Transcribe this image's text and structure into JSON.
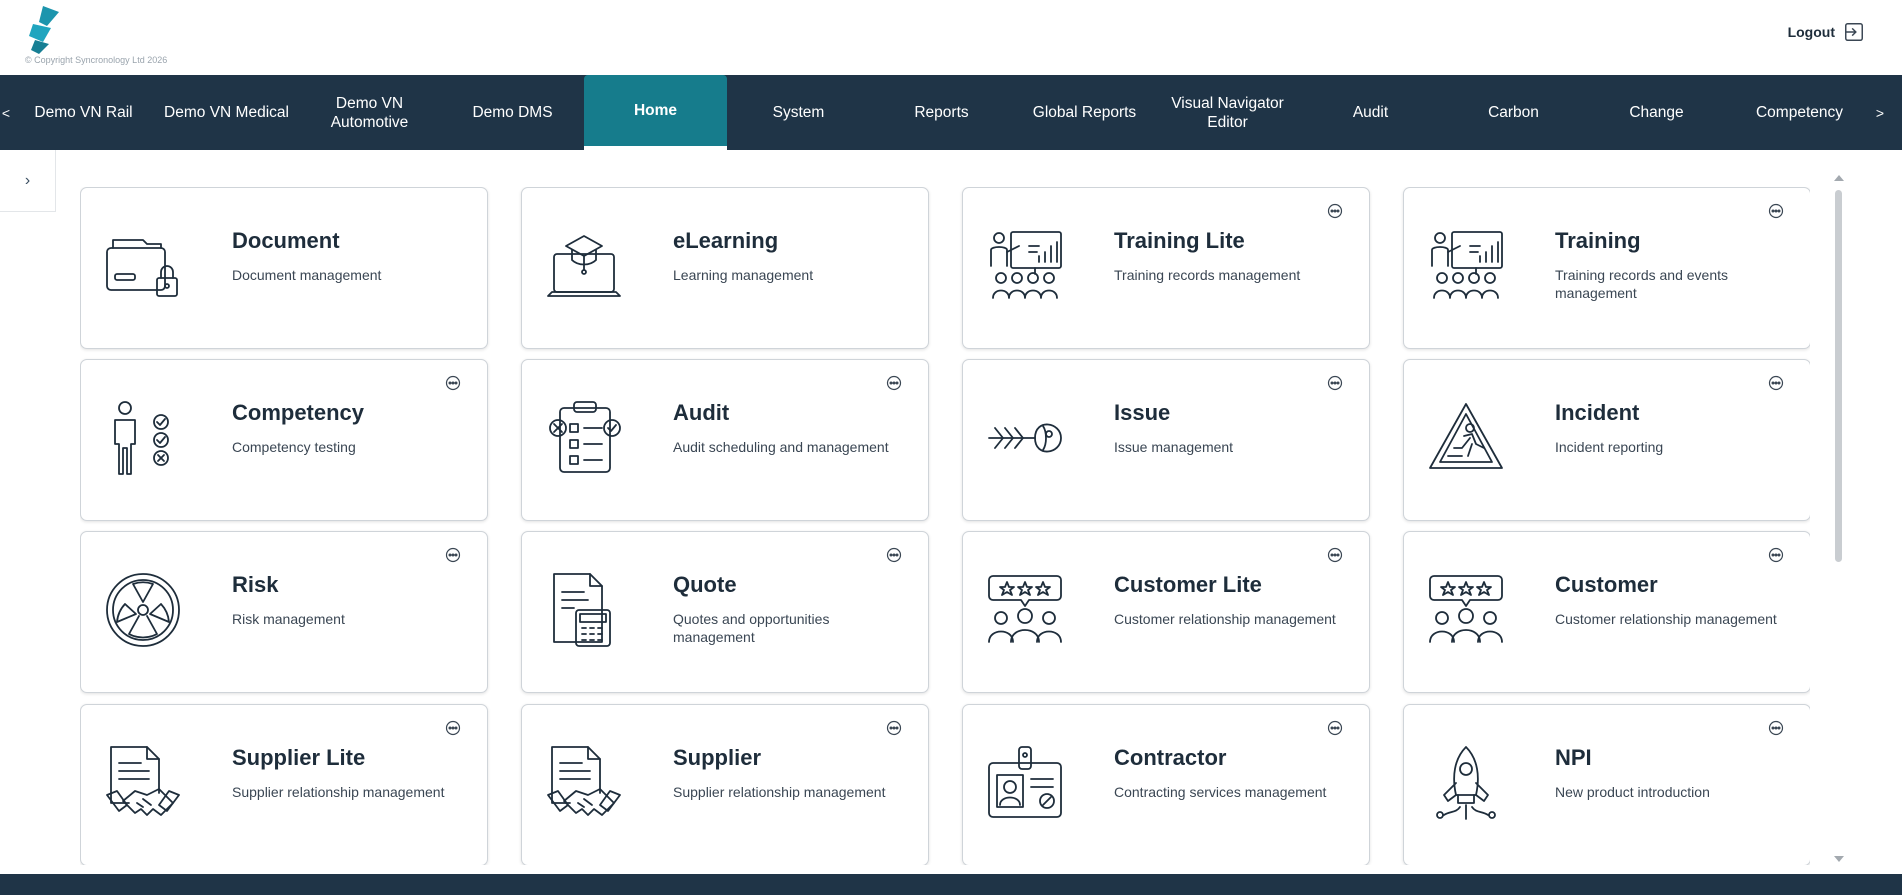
{
  "header": {
    "copyright": "© Copyright Syncronology Ltd 2026",
    "logout_label": "Logout"
  },
  "nav": {
    "left_arrow": "<",
    "right_arrow": ">",
    "items": [
      {
        "label": "Demo VN Rail"
      },
      {
        "label": "Demo VN Medical"
      },
      {
        "label": "Demo VN Automotive"
      },
      {
        "label": "Demo DMS"
      },
      {
        "label": "Home"
      },
      {
        "label": "System"
      },
      {
        "label": "Reports"
      },
      {
        "label": "Global Reports"
      },
      {
        "label": "Visual Navigator Editor"
      },
      {
        "label": "Audit"
      },
      {
        "label": "Carbon"
      },
      {
        "label": "Change"
      },
      {
        "label": "Competency"
      }
    ],
    "active": "Home"
  },
  "sidebar": {
    "toggle_glyph": "›"
  },
  "modules": [
    {
      "title": "Document",
      "desc": "Document management",
      "icon": "document-lock-icon",
      "has_menu": false
    },
    {
      "title": "eLearning",
      "desc": "Learning management",
      "icon": "elearning-laptop-icon",
      "has_menu": false
    },
    {
      "title": "Training Lite",
      "desc": "Training records management",
      "icon": "training-presentation-icon",
      "has_menu": true
    },
    {
      "title": "Training",
      "desc": "Training records and events management",
      "icon": "training-presentation-icon",
      "has_menu": true
    },
    {
      "title": "Competency",
      "desc": "Competency testing",
      "icon": "person-checklist-icon",
      "has_menu": true
    },
    {
      "title": "Audit",
      "desc": "Audit scheduling and management",
      "icon": "clipboard-checklist-icon",
      "has_menu": true
    },
    {
      "title": "Issue",
      "desc": "Issue management",
      "icon": "fishbone-icon",
      "has_menu": true
    },
    {
      "title": "Incident",
      "desc": "Incident reporting",
      "icon": "warning-slip-icon",
      "has_menu": true
    },
    {
      "title": "Risk",
      "desc": "Risk management",
      "icon": "radiation-icon",
      "has_menu": true
    },
    {
      "title": "Quote",
      "desc": "Quotes and opportunities management",
      "icon": "document-calculator-icon",
      "has_menu": true
    },
    {
      "title": "Customer Lite",
      "desc": "Customer relationship management",
      "icon": "customer-rating-icon",
      "has_menu": true
    },
    {
      "title": "Customer",
      "desc": "Customer relationship management",
      "icon": "customer-rating-icon",
      "has_menu": true
    },
    {
      "title": "Supplier Lite",
      "desc": "Supplier relationship management",
      "icon": "document-handshake-icon",
      "has_menu": true
    },
    {
      "title": "Supplier",
      "desc": "Supplier relationship management",
      "icon": "document-handshake-icon",
      "has_menu": true
    },
    {
      "title": "Contractor",
      "desc": "Contracting services management",
      "icon": "id-badge-icon",
      "has_menu": true
    },
    {
      "title": "NPI",
      "desc": "New product introduction",
      "icon": "rocket-icon",
      "has_menu": true
    }
  ],
  "colors": {
    "navbar": "#1f3447",
    "active_tab": "#167c8c",
    "brand_teal": "#1c95ad"
  }
}
